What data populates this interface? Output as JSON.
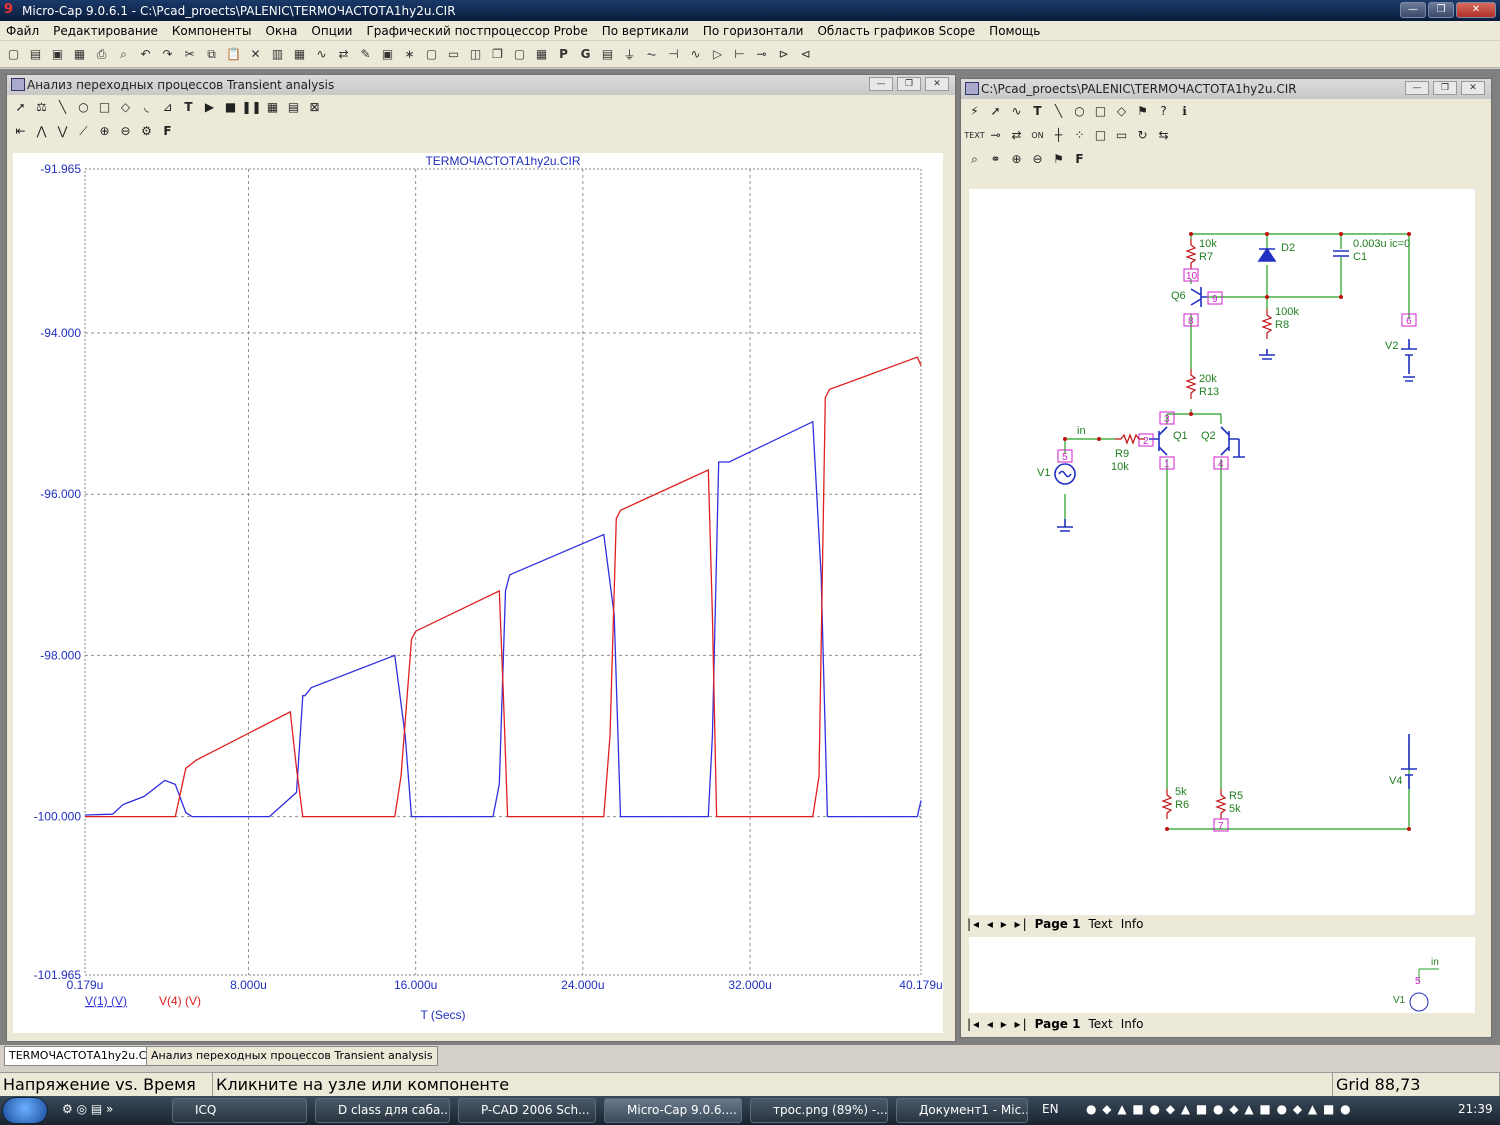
{
  "app": {
    "title": "Micro-Cap 9.0.6.1 - C:\\Pcad_proects\\PALENIC\\TERMOЧАСТОТА1hy2u.CIR",
    "window_controls": [
      "minimize-icon",
      "restore-icon",
      "close-icon"
    ]
  },
  "menu": [
    "Файл",
    "Редактирование",
    "Компоненты",
    "Окна",
    "Опции",
    "Графический постпроцессор Probe",
    "По вертикали",
    "По горизонтали",
    "Область графиков Scope",
    "Помощь"
  ],
  "analysis_window": {
    "title": "Анализ переходных процессов Transient analysis"
  },
  "schematic_window": {
    "title": "C:\\Pcad_proects\\PALENIC\\TERMOЧАСТОТА1hy2u.CIR",
    "page_tabs": [
      "Page 1",
      "Text",
      "Info"
    ],
    "labels": {
      "r7": "R7",
      "r7v": "10k",
      "d2": "D2",
      "c1": "C1",
      "c1v": "0.003u ic=0",
      "q6": "Q6",
      "r8": "R8",
      "r8v": "100k",
      "v2": "V2",
      "r13": "R13",
      "r13v": "20k",
      "q1": "Q1",
      "q2": "Q2",
      "r9": "R9",
      "r9v": "10k",
      "in": "in",
      "v1": "V1",
      "r6": "R6",
      "r6v": "5k",
      "r5": "R5",
      "r5v": "5k",
      "v4": "V4",
      "n10": "10",
      "n9": "9",
      "n8": "8",
      "n6": "6",
      "n3": "3",
      "n2": "2",
      "n1": "1",
      "n4": "4",
      "n5": "5",
      "n7": "7"
    }
  },
  "chart_data": {
    "type": "line",
    "title": "TERMOЧАСТОТА1hy2u.CIR",
    "xlabel": "T (Secs)",
    "ylabel": "",
    "xlim": [
      0.179,
      40.179
    ],
    "ylim": [
      -101.965,
      -91.965
    ],
    "x_tick_labels": [
      "0.179u",
      "8.000u",
      "16.000u",
      "24.000u",
      "32.000u",
      "40.179u"
    ],
    "x_ticks": [
      0.179,
      8,
      16,
      24,
      32,
      40.179
    ],
    "y_tick_labels": [
      "-91.965",
      "-94.000",
      "-96.000",
      "-98.000",
      "-100.000",
      "-101.965"
    ],
    "y_ticks": [
      -91.965,
      -94,
      -96,
      -98,
      -100,
      -101.965
    ],
    "grid": true,
    "series": [
      {
        "name": "V(1) (V)",
        "color": "#3030e0",
        "x": [
          0.179,
          1.5,
          2.0,
          3.0,
          4.0,
          4.5,
          5.0,
          5.3,
          6.0,
          9.0,
          10.3,
          10.6,
          10.7,
          11.0,
          15.0,
          15.5,
          15.8,
          16.0,
          19.7,
          20.0,
          20.3,
          20.5,
          25.0,
          25.5,
          25.8,
          26.0,
          30.0,
          30.2,
          30.5,
          31.0,
          35.0,
          35.4,
          35.7,
          36.0,
          40.0,
          40.179
        ],
        "values": [
          -99.98,
          -99.97,
          -99.85,
          -99.75,
          -99.55,
          -99.6,
          -99.95,
          -100,
          -100,
          -100,
          -99.7,
          -98.5,
          -98.5,
          -98.4,
          -98.0,
          -99.0,
          -100,
          -100,
          -100,
          -99.6,
          -97.2,
          -97.0,
          -96.5,
          -97.5,
          -100,
          -100,
          -100,
          -99.0,
          -95.6,
          -95.6,
          -95.1,
          -97.0,
          -100,
          -100,
          -100,
          -99.8
        ]
      },
      {
        "name": "V(4) (V)",
        "color": "#e02020",
        "x": [
          0.179,
          4.5,
          5.0,
          5.5,
          10.0,
          10.3,
          10.6,
          10.8,
          15.0,
          15.3,
          15.8,
          16.0,
          20.0,
          20.2,
          20.4,
          20.6,
          25.0,
          25.3,
          25.6,
          25.8,
          30.0,
          30.2,
          30.4,
          30.6,
          35.0,
          35.3,
          35.6,
          35.8,
          40.0,
          40.179
        ],
        "values": [
          -100,
          -100,
          -99.4,
          -99.3,
          -98.7,
          -99.4,
          -100,
          -100,
          -100,
          -99.5,
          -97.8,
          -97.7,
          -97.2,
          -98.5,
          -100,
          -100,
          -100,
          -99.0,
          -96.3,
          -96.2,
          -95.7,
          -97.5,
          -100,
          -100,
          -100,
          -99.5,
          -94.8,
          -94.7,
          -94.3,
          -94.4
        ]
      }
    ]
  },
  "legend": [
    "V(1) (V)",
    "V(4) (V)"
  ],
  "mdi_tabs": [
    "TERMOЧАСТОТА1hy2u.CIR",
    "Анализ переходных процессов Transient analysis"
  ],
  "status": {
    "mode": "Напряжение vs. Время",
    "hint": "Кликните на узле или компоненте",
    "grid": "Grid 88,73"
  },
  "taskbar": {
    "tasks": [
      "ICQ",
      "D class для саба...",
      "P-CAD 2006 Sch...",
      "Micro-Cap 9.0.6....",
      "трос.png (89%) -...",
      "Документ1 - Mic..."
    ],
    "lang": "EN",
    "time": "21:39"
  }
}
